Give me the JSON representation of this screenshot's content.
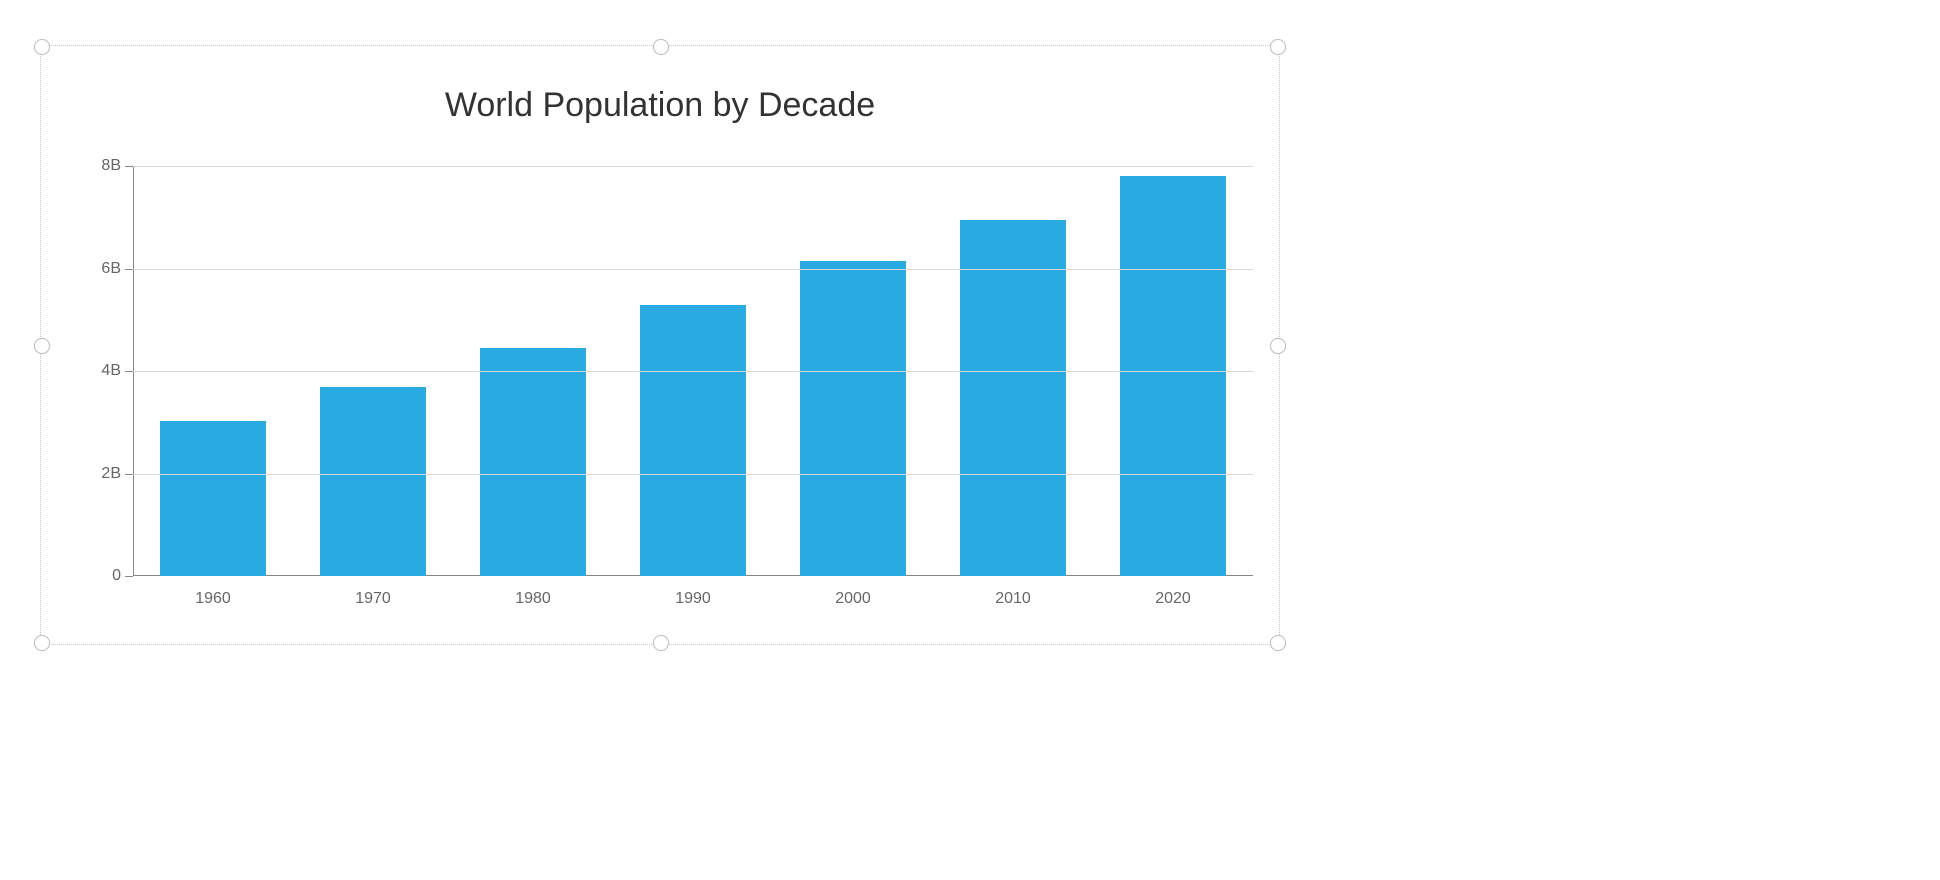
{
  "chart_data": {
    "type": "bar",
    "title": "World Population by Decade",
    "xlabel": "",
    "ylabel": "",
    "categories": [
      "1960",
      "1970",
      "1980",
      "1990",
      "2000",
      "2010",
      "2020"
    ],
    "values": [
      3030000000,
      3680000000,
      4440000000,
      5290000000,
      6140000000,
      6950000000,
      7800000000
    ],
    "ylim": [
      0,
      8000000000
    ],
    "y_ticks": [
      0,
      2000000000,
      4000000000,
      6000000000,
      8000000000
    ],
    "y_tick_labels": [
      "0",
      "2B",
      "4B",
      "6B",
      "8B"
    ],
    "bar_color": "#29abe2",
    "grid": true
  }
}
